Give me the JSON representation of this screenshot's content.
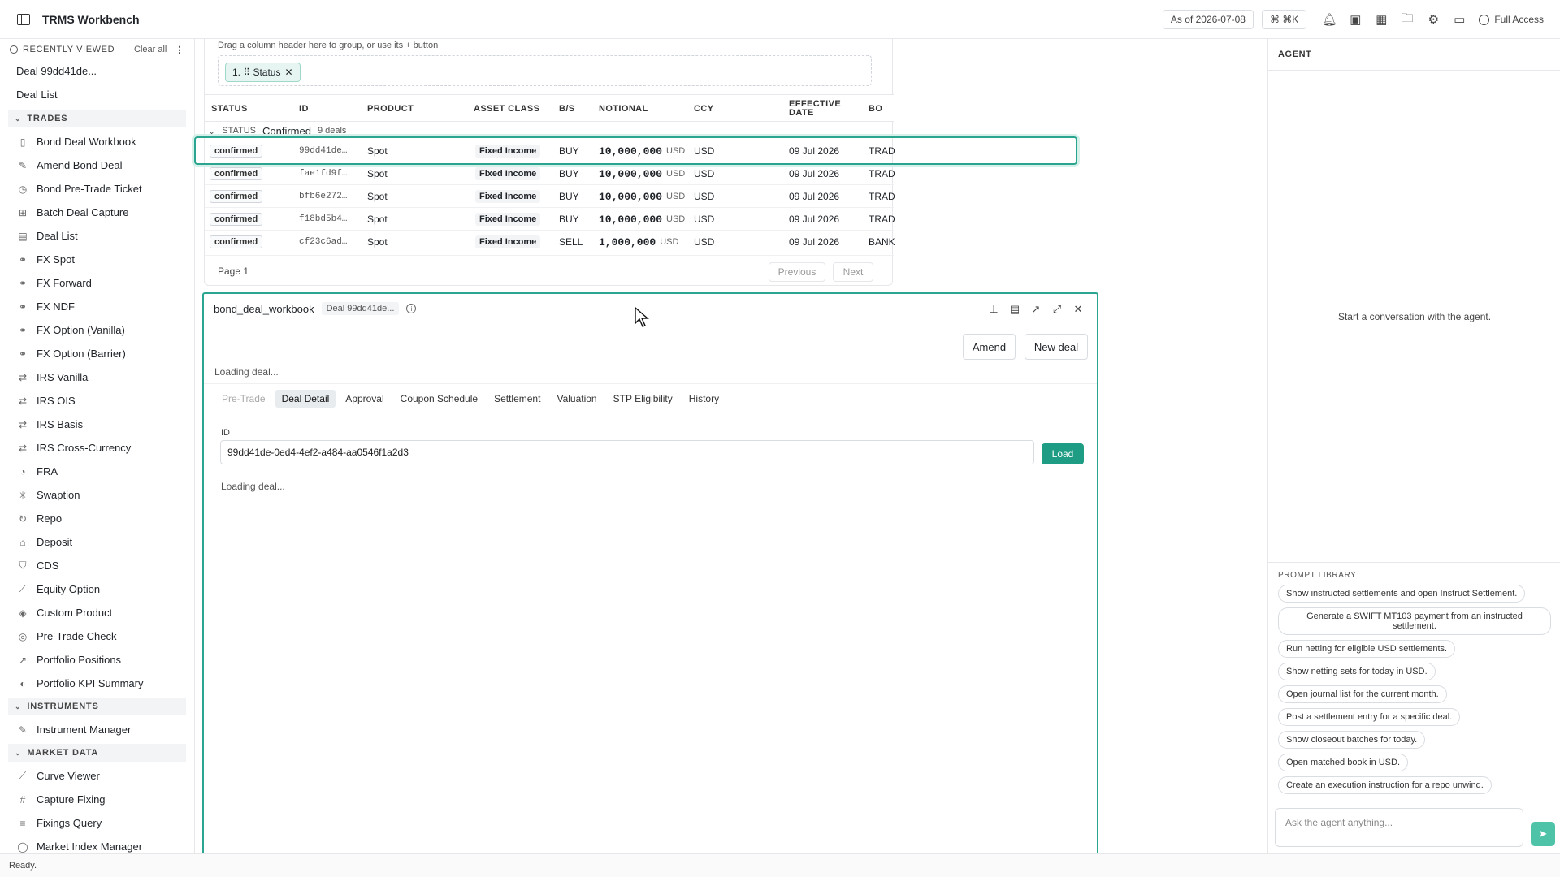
{
  "app": {
    "title": "TRMS Workbench"
  },
  "topbar": {
    "as_of": "As of 2026-07-08",
    "shortcut": "⌘ ⌘K",
    "access": "Full Access"
  },
  "sidebar": {
    "recent_title": "RECENTLY VIEWED",
    "clear_all": "Clear all",
    "recent": [
      "Deal 99dd41de...",
      "Deal List"
    ],
    "sections": [
      {
        "title": "TRADES",
        "items": [
          {
            "label": "Bond Deal Workbook",
            "icon": "book-icon"
          },
          {
            "label": "Amend Bond Deal",
            "icon": "file-edit-icon"
          },
          {
            "label": "Bond Pre-Trade Ticket",
            "icon": "clock-icon"
          },
          {
            "label": "Batch Deal Capture",
            "icon": "file-plus-icon"
          },
          {
            "label": "Deal List",
            "icon": "file-icon"
          },
          {
            "label": "FX Spot",
            "icon": "link-icon"
          },
          {
            "label": "FX Forward",
            "icon": "link-icon"
          },
          {
            "label": "FX NDF",
            "icon": "link-icon"
          },
          {
            "label": "FX Option (Vanilla)",
            "icon": "link-icon"
          },
          {
            "label": "FX Option (Barrier)",
            "icon": "link-icon"
          },
          {
            "label": "IRS Vanilla",
            "icon": "swap-icon"
          },
          {
            "label": "IRS OIS",
            "icon": "swap-icon"
          },
          {
            "label": "IRS Basis",
            "icon": "swap-icon"
          },
          {
            "label": "IRS Cross-Currency",
            "icon": "swap-icon"
          },
          {
            "label": "FRA",
            "icon": "timer-icon"
          },
          {
            "label": "Swaption",
            "icon": "sparkle-icon"
          },
          {
            "label": "Repo",
            "icon": "refresh-icon"
          },
          {
            "label": "Deposit",
            "icon": "bank-icon"
          },
          {
            "label": "CDS",
            "icon": "shield-icon"
          },
          {
            "label": "Equity Option",
            "icon": "chart-line-icon"
          },
          {
            "label": "Custom Product",
            "icon": "cube-icon"
          },
          {
            "label": "Pre-Trade Check",
            "icon": "check-circle-icon"
          },
          {
            "label": "Portfolio Positions",
            "icon": "trend-icon"
          },
          {
            "label": "Portfolio KPI Summary",
            "icon": "gauge-icon"
          }
        ]
      },
      {
        "title": "INSTRUMENTS",
        "items": [
          {
            "label": "Instrument Manager",
            "icon": "file-edit-icon"
          }
        ]
      },
      {
        "title": "MARKET DATA",
        "items": [
          {
            "label": "Curve Viewer",
            "icon": "chart-line-icon"
          },
          {
            "label": "Capture Fixing",
            "icon": "hash-icon"
          },
          {
            "label": "Fixings Query",
            "icon": "database-icon"
          },
          {
            "label": "Market Index Manager",
            "icon": "globe-icon"
          }
        ]
      }
    ]
  },
  "grid": {
    "group_hint": "Drag a column header here to group, or use its + button",
    "group_chip": "1.  ⠿ Status",
    "columns": [
      {
        "label": "STATUS"
      },
      {
        "label": "ID"
      },
      {
        "label": "PRODUCT"
      },
      {
        "label": "ASSET CLASS"
      },
      {
        "label": "B/S"
      },
      {
        "label": "NOTIONAL"
      },
      {
        "label": "CCY"
      },
      {
        "label": "EFFECTIVE DATE"
      },
      {
        "label": "BO"
      }
    ],
    "group_row": {
      "field": "STATUS",
      "value": "Confirmed",
      "count": "9 deals"
    },
    "rows": [
      {
        "status": "confirmed",
        "id": "99dd41de…",
        "product": "Spot",
        "asset_class": "Fixed Income",
        "bs": "BUY",
        "notional": "10,000,000",
        "notional_ccy": "USD",
        "ccy": "USD",
        "effective_date": "09 Jul 2026",
        "bo": "TRAD"
      },
      {
        "status": "confirmed",
        "id": "fae1fd9f…",
        "product": "Spot",
        "asset_class": "Fixed Income",
        "bs": "BUY",
        "notional": "10,000,000",
        "notional_ccy": "USD",
        "ccy": "USD",
        "effective_date": "09 Jul 2026",
        "bo": "TRAD"
      },
      {
        "status": "confirmed",
        "id": "bfb6e272…",
        "product": "Spot",
        "asset_class": "Fixed Income",
        "bs": "BUY",
        "notional": "10,000,000",
        "notional_ccy": "USD",
        "ccy": "USD",
        "effective_date": "09 Jul 2026",
        "bo": "TRAD"
      },
      {
        "status": "confirmed",
        "id": "f18bd5b4…",
        "product": "Spot",
        "asset_class": "Fixed Income",
        "bs": "BUY",
        "notional": "10,000,000",
        "notional_ccy": "USD",
        "ccy": "USD",
        "effective_date": "09 Jul 2026",
        "bo": "TRAD"
      },
      {
        "status": "confirmed",
        "id": "cf23c6ad…",
        "product": "Spot",
        "asset_class": "Fixed Income",
        "bs": "SELL",
        "notional": "1,000,000",
        "notional_ccy": "USD",
        "ccy": "USD",
        "effective_date": "09 Jul 2026",
        "bo": "BANK"
      }
    ],
    "page": "Page 1",
    "prev": "Previous",
    "next": "Next"
  },
  "workbook": {
    "title": "bond_deal_workbook",
    "tag": "Deal 99dd41de...",
    "amend": "Amend",
    "new_deal": "New deal",
    "loading": "Loading deal...",
    "tabs": [
      {
        "label": "Pre-Trade",
        "state": "disabled"
      },
      {
        "label": "Deal Detail",
        "state": "active"
      },
      {
        "label": "Approval",
        "state": "normal"
      },
      {
        "label": "Coupon Schedule",
        "state": "normal"
      },
      {
        "label": "Settlement",
        "state": "normal"
      },
      {
        "label": "Valuation",
        "state": "normal"
      },
      {
        "label": "STP Eligibility",
        "state": "normal"
      },
      {
        "label": "History",
        "state": "normal"
      }
    ],
    "id_label": "ID",
    "id_value": "99dd41de-0ed4-4ef2-a484-aa0546f1a2d3",
    "load": "Load",
    "loading2": "Loading deal..."
  },
  "agent": {
    "title": "AGENT",
    "empty": "Start a conversation with the agent.",
    "library_title": "PROMPT LIBRARY",
    "prompts": [
      "Show instructed settlements and open Instruct Settlement.",
      "Generate a SWIFT MT103 payment from an instructed settlement.",
      "Run netting for eligible USD settlements.",
      "Show netting sets for today in USD.",
      "Open journal list for the current month.",
      "Post a settlement entry for a specific deal.",
      "Show closeout batches for today.",
      "Open matched book in USD.",
      "Create an execution instruction for a repo unwind."
    ],
    "input_placeholder": "Ask the agent anything..."
  },
  "status_bar": "Ready.",
  "colors": {
    "accent": "#2ba58f",
    "accent_fill": "#1f9c84"
  }
}
